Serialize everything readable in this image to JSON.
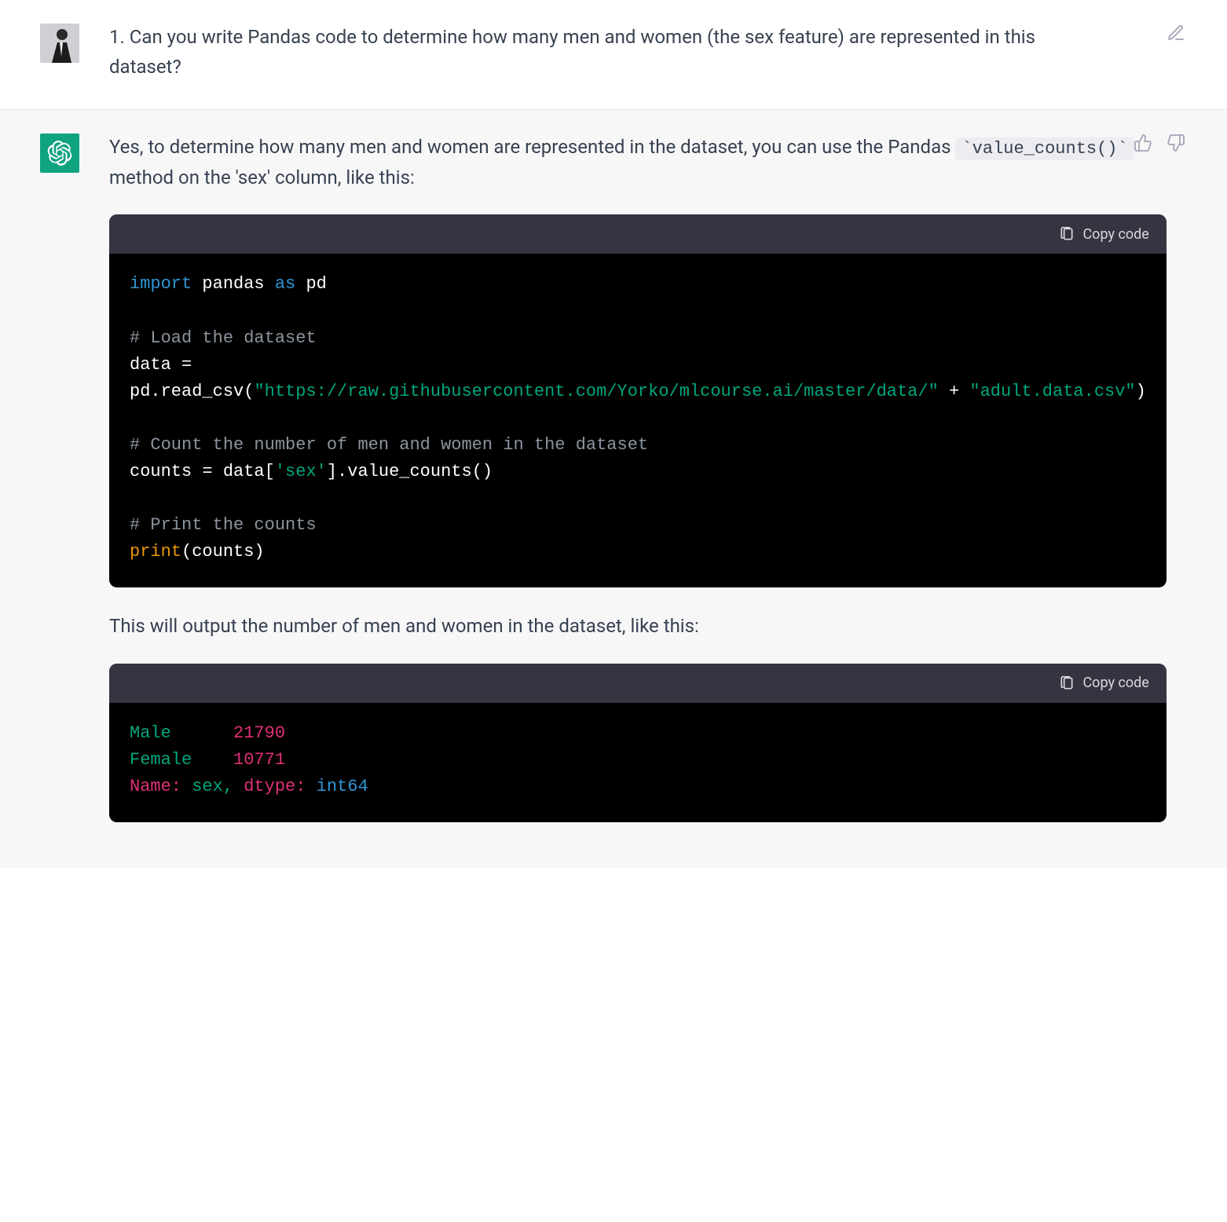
{
  "user_message": {
    "text": "1. Can you write Pandas code to determine how many men and women (the sex feature) are represented in this dataset?"
  },
  "assistant_message": {
    "intro_prefix": "Yes, to determine how many men and women are represented in the dataset, you can use the Pandas ",
    "inline_code": "`value_counts()`",
    "intro_suffix": " method on the 'sex' column, like this:",
    "outro": "This will output the number of men and women in the dataset, like this:"
  },
  "code_block_1": {
    "copy_label": "Copy code",
    "tokens": {
      "import": "import",
      "pandas": " pandas ",
      "as": "as",
      "pd": " pd",
      "cmt1": "# Load the dataset",
      "line_data": "data = ",
      "line_read": "pd.read_csv(",
      "url": "\"https://raw.githubusercontent.com/Yorko/mlcourse.ai/master/data/\"",
      "plus": " + ",
      "csv": "\"adult.data.csv\"",
      "close_paren": ")",
      "cmt2": "# Count the number of men and women in the dataset",
      "line_counts_a": "counts = data[",
      "sex": "'sex'",
      "line_counts_b": "].value_counts()",
      "cmt3": "# Print the counts",
      "print": "print",
      "print_args": "(counts)"
    }
  },
  "code_block_2": {
    "copy_label": "Copy code",
    "tokens": {
      "male": "Male",
      "male_n": "21790",
      "female": "Female",
      "female_n": "10771",
      "name_prefix": "Name: ",
      "name_val": "sex, ",
      "dtype_prefix": "dtype: ",
      "dtype_val": "int64"
    }
  }
}
